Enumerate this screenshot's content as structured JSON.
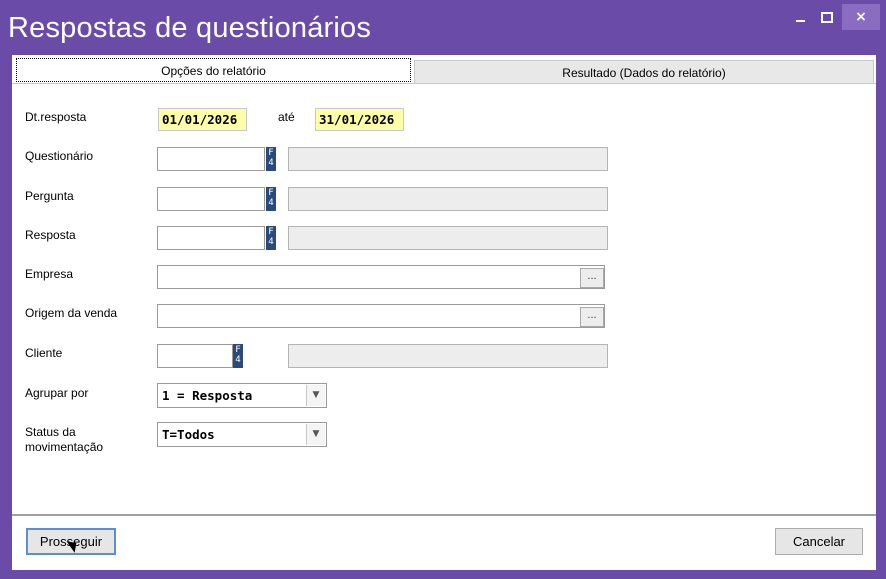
{
  "window": {
    "title": "Respostas de questionários",
    "controls": {
      "minimize": "–",
      "maximize": "□",
      "close": "×"
    }
  },
  "tabs": [
    {
      "label": "Opções do relatório",
      "active": true
    },
    {
      "label": "Resultado (Dados do relatório)",
      "active": false
    }
  ],
  "form": {
    "dt_resposta": {
      "label": "Dt.resposta",
      "from": "01/01/2026",
      "sep": "até",
      "to": "31/01/2026"
    },
    "questionario": {
      "label": "Questionário",
      "value": "",
      "f4": "F4",
      "desc": ""
    },
    "pergunta": {
      "label": "Pergunta",
      "value": "",
      "f4": "F4",
      "desc": ""
    },
    "resposta": {
      "label": "Resposta",
      "value": "",
      "f4": "F4",
      "desc": ""
    },
    "empresa": {
      "label": "Empresa",
      "value": "",
      "lookup": "..."
    },
    "origem": {
      "label": "Origem da venda",
      "value": "",
      "lookup": "..."
    },
    "cliente": {
      "label": "Cliente",
      "value": "",
      "f4": "F4",
      "desc": ""
    },
    "agrupar": {
      "label": "Agrupar por",
      "value": "1 = Resposta"
    },
    "status": {
      "label": "Status da movimentação",
      "value": "T=Todos"
    }
  },
  "buttons": {
    "proceed": "Prosseguir",
    "cancel": "Cancelar"
  },
  "colors": {
    "title_bar": "#6a4ba7",
    "date_bg": "#ffffa8",
    "f4_bg": "#2a4a7a"
  }
}
